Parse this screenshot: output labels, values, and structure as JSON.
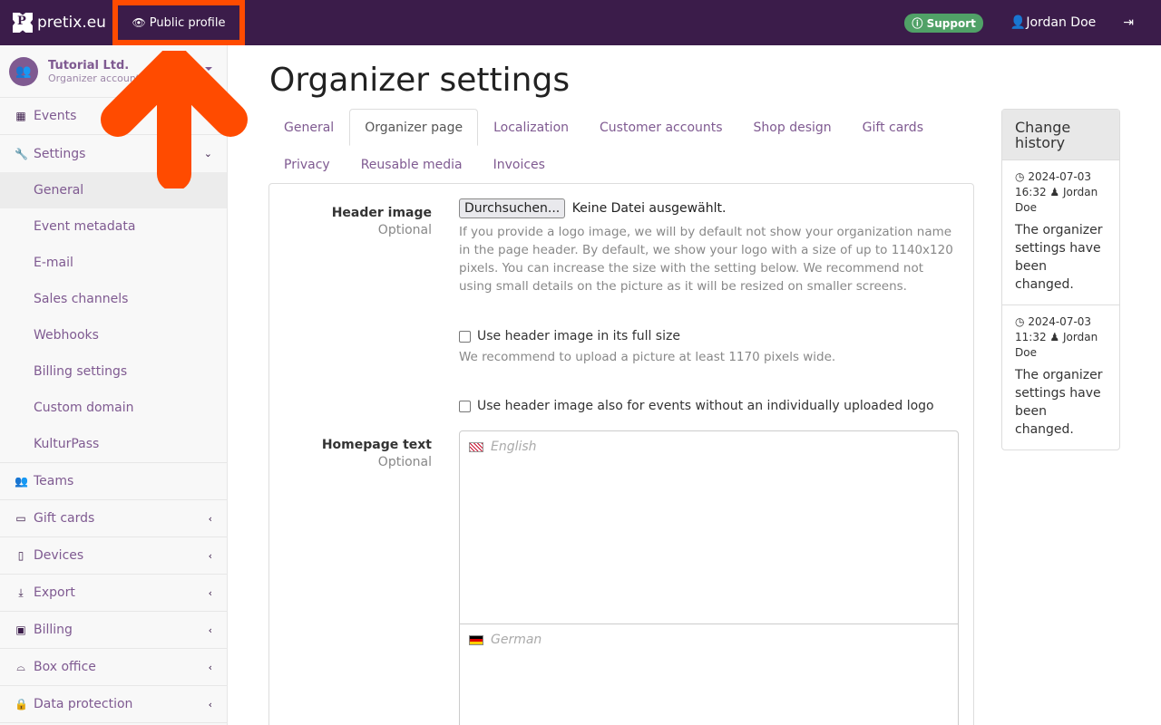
{
  "topbar": {
    "brand": "pretix.eu",
    "public_profile": "Public profile",
    "support": "Support",
    "user": "Jordan Doe",
    "icons": {
      "eye": "eye-icon",
      "question": "question-circle-icon",
      "user": "user-icon",
      "logout": "sign-out-icon"
    }
  },
  "sidebar": {
    "org_name": "Tutorial Ltd.",
    "org_sub": "Organizer account",
    "items": [
      {
        "label": "Events",
        "icon": "calendar-icon",
        "chevron": ""
      },
      {
        "label": "Settings",
        "icon": "wrench-icon",
        "chevron": "down"
      },
      {
        "label": "Teams",
        "icon": "group-icon",
        "chevron": ""
      },
      {
        "label": "Gift cards",
        "icon": "credit-card-icon",
        "chevron": "left"
      },
      {
        "label": "Devices",
        "icon": "tablet-icon",
        "chevron": "left"
      },
      {
        "label": "Export",
        "icon": "download-icon",
        "chevron": "left"
      },
      {
        "label": "Billing",
        "icon": "money-icon",
        "chevron": "left"
      },
      {
        "label": "Box office",
        "icon": "basket-icon",
        "chevron": "left"
      },
      {
        "label": "Data protection",
        "icon": "lock-icon",
        "chevron": "left"
      }
    ],
    "settings_sub": [
      {
        "label": "General",
        "active": true
      },
      {
        "label": "Event metadata"
      },
      {
        "label": "E-mail"
      },
      {
        "label": "Sales channels"
      },
      {
        "label": "Webhooks"
      },
      {
        "label": "Billing settings"
      },
      {
        "label": "Custom domain"
      },
      {
        "label": "KulturPass"
      }
    ]
  },
  "main": {
    "title": "Organizer settings",
    "tabs_row1": [
      "General",
      "Organizer page",
      "Localization",
      "Customer accounts",
      "Shop design",
      "Gift cards"
    ],
    "tabs_row2": [
      "Privacy",
      "Reusable media",
      "Invoices"
    ],
    "active_tab": "Organizer page",
    "header_image": {
      "label": "Header image",
      "optional": "Optional",
      "browse": "Durchsuchen...",
      "no_file": "Keine Datei ausgewählt.",
      "help": "If you provide a logo image, we will by default not show your organization name in the page header. By default, we show your logo with a size of up to 1140x120 pixels. You can increase the size with the setting below. We recommend not using small details on the picture as it will be resized on smaller screens."
    },
    "full_size": {
      "label": "Use header image in its full size",
      "checked": false,
      "help": "We recommend to upload a picture at least 1170 pixels wide."
    },
    "use_for_events": {
      "label": "Use header image also for events without an individually uploaded logo",
      "checked": false
    },
    "homepage_text": {
      "label": "Homepage text",
      "optional": "Optional",
      "lang_en": "English",
      "lang_de": "German",
      "value_en": "",
      "value_de": ""
    }
  },
  "history": {
    "title": "Change history",
    "entries": [
      {
        "date": "2024-07-03",
        "time": "16:32",
        "user": "Jordan Doe",
        "text": "The organizer settings have been changed."
      },
      {
        "date": "2024-07-03",
        "time": "11:32",
        "user": "Jordan Doe",
        "text": "The organizer settings have been changed."
      }
    ]
  },
  "annotation": {
    "highlight": "Public profile",
    "arrow_color": "#ff4b00"
  }
}
